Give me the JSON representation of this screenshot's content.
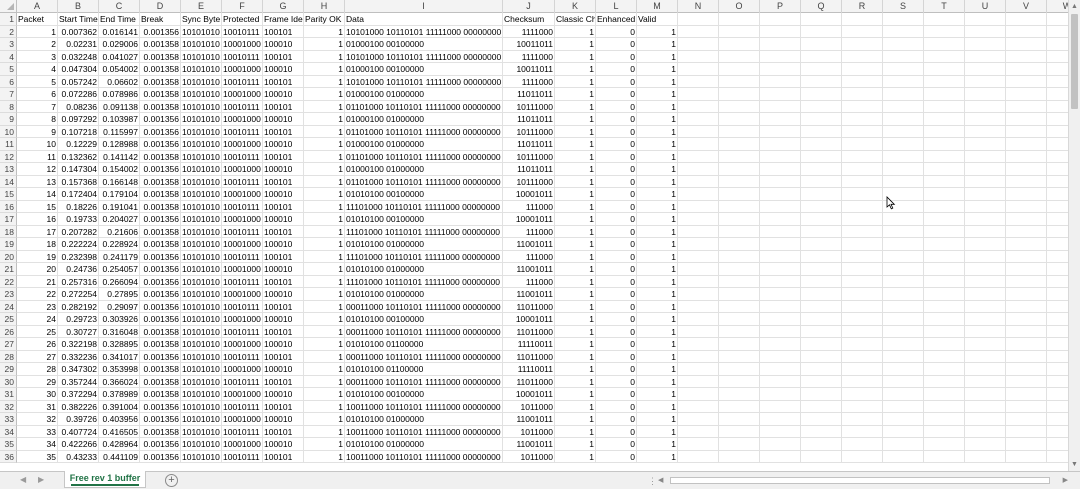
{
  "columns": [
    "A",
    "B",
    "C",
    "D",
    "E",
    "F",
    "G",
    "H",
    "I",
    "J",
    "K",
    "L",
    "M",
    "N",
    "O",
    "P",
    "Q",
    "R",
    "S",
    "T",
    "U",
    "V",
    "W"
  ],
  "headers": [
    "Packet",
    "Start Time",
    "End Time",
    "Break",
    "Sync Byte",
    "Protected",
    "Frame Ide",
    "Parity OK",
    "Data",
    "Checksum",
    "Classic Ch",
    "Enhanced",
    "Valid"
  ],
  "rows": [
    [
      "1",
      "0.007362",
      "0.016141",
      "0.001356",
      "10101010",
      "10010111",
      "100101",
      "1",
      "10101000 10110101 11111000 00000000",
      "1111000",
      "1",
      "0",
      "1"
    ],
    [
      "2",
      "0.02231",
      "0.029006",
      "0.001358",
      "10101010",
      "10001000",
      "100010",
      "1",
      "01000100 00100000",
      "10011011",
      "1",
      "0",
      "1"
    ],
    [
      "3",
      "0.032248",
      "0.041027",
      "0.001358",
      "10101010",
      "10010111",
      "100101",
      "1",
      "10101000 10110101 11111000 00000000",
      "1111000",
      "1",
      "0",
      "1"
    ],
    [
      "4",
      "0.047304",
      "0.054002",
      "0.001358",
      "10101010",
      "10001000",
      "100010",
      "1",
      "01000100 00100000",
      "10011011",
      "1",
      "0",
      "1"
    ],
    [
      "5",
      "0.057242",
      "0.06602",
      "0.001358",
      "10101010",
      "10010111",
      "100101",
      "1",
      "10101000 10110101 11111000 00000000",
      "1111000",
      "1",
      "0",
      "1"
    ],
    [
      "6",
      "0.072286",
      "0.078986",
      "0.001358",
      "10101010",
      "10001000",
      "100010",
      "1",
      "01000100 01000000",
      "11011011",
      "1",
      "0",
      "1"
    ],
    [
      "7",
      "0.08236",
      "0.091138",
      "0.001358",
      "10101010",
      "10010111",
      "100101",
      "1",
      "01101000 10110101 11111000 00000000",
      "10111000",
      "1",
      "0",
      "1"
    ],
    [
      "8",
      "0.097292",
      "0.103987",
      "0.001356",
      "10101010",
      "10001000",
      "100010",
      "1",
      "01000100 01000000",
      "11011011",
      "1",
      "0",
      "1"
    ],
    [
      "9",
      "0.107218",
      "0.115997",
      "0.001356",
      "10101010",
      "10010111",
      "100101",
      "1",
      "01101000 10110101 11111000 00000000",
      "10111000",
      "1",
      "0",
      "1"
    ],
    [
      "10",
      "0.12229",
      "0.128988",
      "0.001356",
      "10101010",
      "10001000",
      "100010",
      "1",
      "01000100 01000000",
      "11011011",
      "1",
      "0",
      "1"
    ],
    [
      "11",
      "0.132362",
      "0.141142",
      "0.001358",
      "10101010",
      "10010111",
      "100101",
      "1",
      "01101000 10110101 11111000 00000000",
      "10111000",
      "1",
      "0",
      "1"
    ],
    [
      "12",
      "0.147304",
      "0.154002",
      "0.001356",
      "10101010",
      "10001000",
      "100010",
      "1",
      "01000100 01000000",
      "11011011",
      "1",
      "0",
      "1"
    ],
    [
      "13",
      "0.157368",
      "0.166148",
      "0.001358",
      "10101010",
      "10010111",
      "100101",
      "1",
      "01101000 10110101 11111000 00000000",
      "10111000",
      "1",
      "0",
      "1"
    ],
    [
      "14",
      "0.172404",
      "0.179104",
      "0.001358",
      "10101010",
      "10001000",
      "100010",
      "1",
      "01010100 00100000",
      "10001011",
      "1",
      "0",
      "1"
    ],
    [
      "15",
      "0.18226",
      "0.191041",
      "0.001358",
      "10101010",
      "10010111",
      "100101",
      "1",
      "11101000 10110101 11111000 00000000",
      "111000",
      "1",
      "0",
      "1"
    ],
    [
      "16",
      "0.19733",
      "0.204027",
      "0.001356",
      "10101010",
      "10001000",
      "100010",
      "1",
      "01010100 00100000",
      "10001011",
      "1",
      "0",
      "1"
    ],
    [
      "17",
      "0.207282",
      "0.21606",
      "0.001358",
      "10101010",
      "10010111",
      "100101",
      "1",
      "11101000 10110101 11111000 00000000",
      "111000",
      "1",
      "0",
      "1"
    ],
    [
      "18",
      "0.222224",
      "0.228924",
      "0.001358",
      "10101010",
      "10001000",
      "100010",
      "1",
      "01010100 01000000",
      "11001011",
      "1",
      "0",
      "1"
    ],
    [
      "19",
      "0.232398",
      "0.241179",
      "0.001356",
      "10101010",
      "10010111",
      "100101",
      "1",
      "11101000 10110101 11111000 00000000",
      "111000",
      "1",
      "0",
      "1"
    ],
    [
      "20",
      "0.24736",
      "0.254057",
      "0.001356",
      "10101010",
      "10001000",
      "100010",
      "1",
      "01010100 01000000",
      "11001011",
      "1",
      "0",
      "1"
    ],
    [
      "21",
      "0.257316",
      "0.266094",
      "0.001356",
      "10101010",
      "10010111",
      "100101",
      "1",
      "11101000 10110101 11111000 00000000",
      "111000",
      "1",
      "0",
      "1"
    ],
    [
      "22",
      "0.272254",
      "0.27895",
      "0.001356",
      "10101010",
      "10001000",
      "100010",
      "1",
      "01010100 01000000",
      "11001011",
      "1",
      "0",
      "1"
    ],
    [
      "23",
      "0.282192",
      "0.29097",
      "0.001356",
      "10101010",
      "10010111",
      "100101",
      "1",
      "00011000 10110101 11111000 00000000",
      "11011000",
      "1",
      "0",
      "1"
    ],
    [
      "24",
      "0.29723",
      "0.303926",
      "0.001356",
      "10101010",
      "10001000",
      "100010",
      "1",
      "01010100 00100000",
      "10001011",
      "1",
      "0",
      "1"
    ],
    [
      "25",
      "0.30727",
      "0.316048",
      "0.001358",
      "10101010",
      "10010111",
      "100101",
      "1",
      "00011000 10110101 11111000 00000000",
      "11011000",
      "1",
      "0",
      "1"
    ],
    [
      "26",
      "0.322198",
      "0.328895",
      "0.001358",
      "10101010",
      "10001000",
      "100010",
      "1",
      "01010100 01100000",
      "11110011",
      "1",
      "0",
      "1"
    ],
    [
      "27",
      "0.332236",
      "0.341017",
      "0.001356",
      "10101010",
      "10010111",
      "100101",
      "1",
      "00011000 10110101 11111000 00000000",
      "11011000",
      "1",
      "0",
      "1"
    ],
    [
      "28",
      "0.347302",
      "0.353998",
      "0.001358",
      "10101010",
      "10001000",
      "100010",
      "1",
      "01010100 01100000",
      "11110011",
      "1",
      "0",
      "1"
    ],
    [
      "29",
      "0.357244",
      "0.366024",
      "0.001358",
      "10101010",
      "10010111",
      "100101",
      "1",
      "00011000 10110101 11111000 00000000",
      "11011000",
      "1",
      "0",
      "1"
    ],
    [
      "30",
      "0.372294",
      "0.378989",
      "0.001358",
      "10101010",
      "10001000",
      "100010",
      "1",
      "01010100 00100000",
      "10001011",
      "1",
      "0",
      "1"
    ],
    [
      "31",
      "0.382226",
      "0.391004",
      "0.001356",
      "10101010",
      "10010111",
      "100101",
      "1",
      "10011000 10110101 11111000 00000000",
      "1011000",
      "1",
      "0",
      "1"
    ],
    [
      "32",
      "0.39726",
      "0.403956",
      "0.001356",
      "10101010",
      "10001000",
      "100010",
      "1",
      "01010100 01000000",
      "11001011",
      "1",
      "0",
      "1"
    ],
    [
      "33",
      "0.407724",
      "0.416505",
      "0.001358",
      "10101010",
      "10010111",
      "100101",
      "1",
      "10011000 10110101 11111000 00000000",
      "1011000",
      "1",
      "0",
      "1"
    ],
    [
      "34",
      "0.422266",
      "0.428964",
      "0.001356",
      "10101010",
      "10001000",
      "100010",
      "1",
      "01010100 01000000",
      "11001011",
      "1",
      "0",
      "1"
    ],
    [
      "35",
      "0.43233",
      "0.441109",
      "0.001356",
      "10101010",
      "10010111",
      "100101",
      "1",
      "10011000 10110101 11111000 00000000",
      "1011000",
      "1",
      "0",
      "1"
    ]
  ],
  "sheet_tab": {
    "label": "Free rev 1 buffer",
    "add_label": "+"
  },
  "nav": {
    "prev": "◀",
    "next": "▶",
    "split": "⋮"
  },
  "icons": {
    "corner": "select-all-icon",
    "cursor": "mouse-pointer-icon"
  },
  "colors": {
    "accent": "#217346",
    "header_bg": "#f3f3f3",
    "grid": "#e1e1e1"
  }
}
